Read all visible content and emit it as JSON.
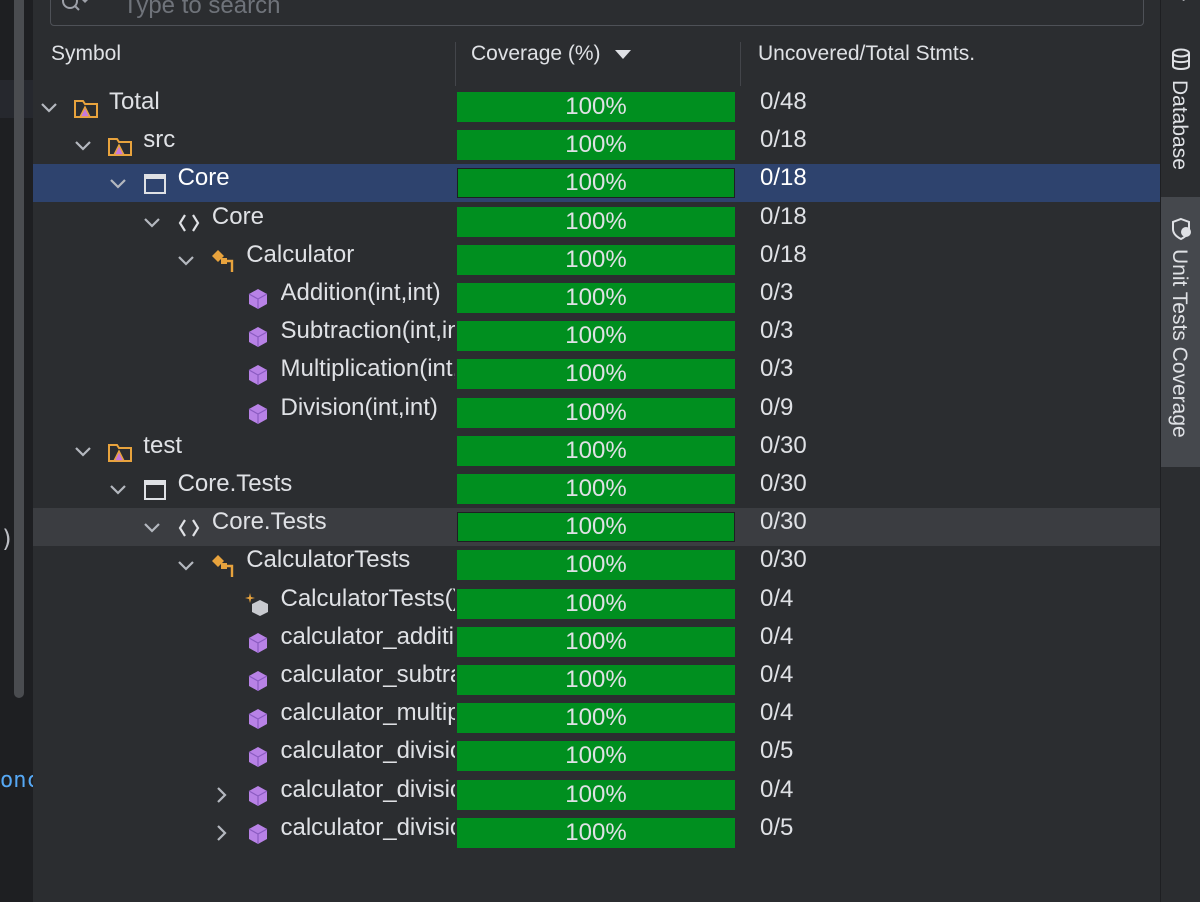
{
  "search": {
    "placeholder": "Type to search"
  },
  "columns": {
    "symbol": "Symbol",
    "coverage": "Coverage (%)",
    "stmts": "Uncovered/Total Stmts."
  },
  "right_tabs": {
    "top_partial": "r",
    "database": "Database",
    "coverage": "Unit Tests Coverage"
  },
  "editor": {
    "paren": ")",
    "keyword": "onc"
  },
  "rows": [
    {
      "label": "Total",
      "icon": "project-folder-icon",
      "expanded": true,
      "coverage": "100%",
      "stmts": "0/48"
    },
    {
      "label": "src",
      "icon": "project-folder-icon",
      "expanded": true,
      "coverage": "100%",
      "stmts": "0/18"
    },
    {
      "label": "Core",
      "icon": "project-module-icon",
      "expanded": true,
      "coverage": "100%",
      "stmts": "0/18",
      "selected": true
    },
    {
      "label": "Core",
      "icon": "namespace-icon",
      "expanded": true,
      "coverage": "100%",
      "stmts": "0/18"
    },
    {
      "label": "Calculator",
      "icon": "class-icon",
      "expanded": true,
      "coverage": "100%",
      "stmts": "0/18"
    },
    {
      "label": "Addition(int,int)",
      "icon": "method-icon",
      "coverage": "100%",
      "stmts": "0/3"
    },
    {
      "label": "Subtraction(int,int)",
      "icon": "method-icon",
      "coverage": "100%",
      "stmts": "0/3"
    },
    {
      "label": "Multiplication(int,int)",
      "icon": "method-icon",
      "coverage": "100%",
      "stmts": "0/3"
    },
    {
      "label": "Division(int,int)",
      "icon": "method-icon",
      "coverage": "100%",
      "stmts": "0/9"
    },
    {
      "label": "test",
      "icon": "project-folder-icon",
      "expanded": true,
      "coverage": "100%",
      "stmts": "0/30"
    },
    {
      "label": "Core.Tests",
      "icon": "project-module-icon",
      "expanded": true,
      "coverage": "100%",
      "stmts": "0/30"
    },
    {
      "label": "Core.Tests",
      "icon": "namespace-icon",
      "expanded": true,
      "coverage": "100%",
      "stmts": "0/30",
      "hover": true
    },
    {
      "label": "CalculatorTests",
      "icon": "class-icon",
      "expanded": true,
      "coverage": "100%",
      "stmts": "0/30"
    },
    {
      "label": "CalculatorTests()",
      "icon": "constructor-icon",
      "coverage": "100%",
      "stmts": "0/4"
    },
    {
      "label": "calculator_addition",
      "icon": "method-icon",
      "coverage": "100%",
      "stmts": "0/4"
    },
    {
      "label": "calculator_subtraction",
      "icon": "method-icon",
      "coverage": "100%",
      "stmts": "0/4"
    },
    {
      "label": "calculator_multiplication",
      "icon": "method-icon",
      "coverage": "100%",
      "stmts": "0/4"
    },
    {
      "label": "calculator_division",
      "icon": "method-icon",
      "coverage": "100%",
      "stmts": "0/5"
    },
    {
      "label": "calculator_division_by_zero",
      "icon": "method-icon",
      "expanded": false,
      "coverage": "100%",
      "stmts": "0/4"
    },
    {
      "label": "calculator_division_cases",
      "icon": "method-icon",
      "expanded": false,
      "coverage": "100%",
      "stmts": "0/5"
    }
  ]
}
